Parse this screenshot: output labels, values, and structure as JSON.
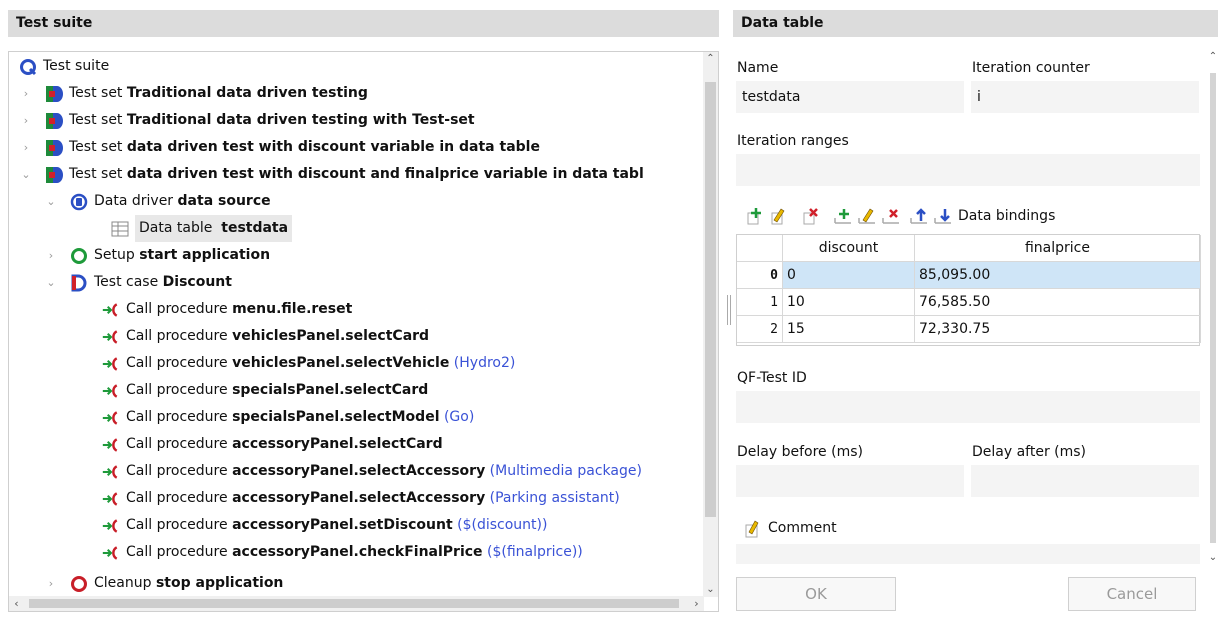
{
  "left_panel": {
    "title": "Test suite"
  },
  "right_panel": {
    "title": "Data table"
  },
  "tree": {
    "root": "Test suite",
    "nodes": [
      {
        "prefix": "Test set ",
        "bold": "Traditional data driven testing",
        "extra": ""
      },
      {
        "prefix": "Test set ",
        "bold": "Traditional data driven testing with Test-set",
        "extra": ""
      },
      {
        "prefix": "Test set ",
        "bold": "data driven test with discount variable in data table",
        "extra": ""
      },
      {
        "prefix": "Test set ",
        "bold": "data driven test with discount and finalprice variable in data tabl",
        "extra": ""
      },
      {
        "prefix": "Data driver ",
        "bold": "data source",
        "extra": ""
      },
      {
        "prefix": "Data table ",
        "bold": "testdata",
        "extra": ""
      },
      {
        "prefix": "Setup ",
        "bold": "start application",
        "extra": ""
      },
      {
        "prefix": "Test case ",
        "bold": "Discount",
        "extra": ""
      },
      {
        "prefix": "Call procedure ",
        "bold": "menu.file.reset",
        "extra": ""
      },
      {
        "prefix": "Call procedure ",
        "bold": "vehiclesPanel.selectCard",
        "extra": ""
      },
      {
        "prefix": "Call procedure ",
        "bold": "vehiclesPanel.selectVehicle",
        "extra": "(Hydro2)"
      },
      {
        "prefix": "Call procedure ",
        "bold": "specialsPanel.selectCard",
        "extra": ""
      },
      {
        "prefix": "Call procedure ",
        "bold": "specialsPanel.selectModel",
        "extra": "(Go)"
      },
      {
        "prefix": "Call procedure ",
        "bold": "accessoryPanel.selectCard",
        "extra": ""
      },
      {
        "prefix": "Call procedure ",
        "bold": "accessoryPanel.selectAccessory",
        "extra": "(Multimedia package)"
      },
      {
        "prefix": "Call procedure ",
        "bold": "accessoryPanel.selectAccessory",
        "extra": "(Parking assistant)"
      },
      {
        "prefix": "Call procedure ",
        "bold": "accessoryPanel.setDiscount",
        "extra": "($(discount))"
      },
      {
        "prefix": "Call procedure ",
        "bold": "accessoryPanel.checkFinalPrice",
        "extra": "($(finalprice))"
      },
      {
        "prefix": "Cleanup ",
        "bold": "stop application",
        "extra": ""
      }
    ]
  },
  "form": {
    "name_label": "Name",
    "name_value": "testdata",
    "counter_label": "Iteration counter",
    "counter_value": "i",
    "ranges_label": "Iteration ranges",
    "ranges_value": "",
    "bindings_label": "Data bindings",
    "qfid_label": "QF-Test ID",
    "qfid_value": "",
    "delay_before_label": "Delay before (ms)",
    "delay_after_label": "Delay after (ms)",
    "comment_label": "Comment"
  },
  "table": {
    "columns": [
      "discount",
      "finalprice"
    ],
    "rows": [
      {
        "index": "0",
        "discount": "0",
        "finalprice": "85,095.00"
      },
      {
        "index": "1",
        "discount": "10",
        "finalprice": "76,585.50"
      },
      {
        "index": "2",
        "discount": "15",
        "finalprice": "72,330.75"
      }
    ]
  },
  "buttons": {
    "ok": "OK",
    "cancel": "Cancel"
  }
}
